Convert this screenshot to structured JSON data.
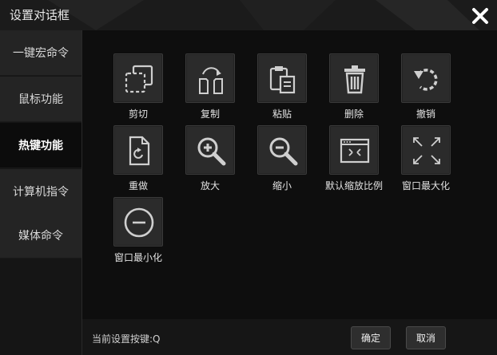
{
  "dialog": {
    "title": "设置对话框"
  },
  "sidebar": {
    "items": [
      {
        "label": "一键宏命令"
      },
      {
        "label": "鼠标功能"
      },
      {
        "label": "热键功能"
      },
      {
        "label": "计算机指令"
      },
      {
        "label": "媒体命令"
      }
    ],
    "active_index": 2
  },
  "tiles": [
    {
      "label": "剪切",
      "icon": "cut-icon"
    },
    {
      "label": "复制",
      "icon": "copy-icon"
    },
    {
      "label": "粘贴",
      "icon": "paste-icon"
    },
    {
      "label": "删除",
      "icon": "trash-icon"
    },
    {
      "label": "撤销",
      "icon": "undo-icon"
    },
    {
      "label": "重做",
      "icon": "redo-icon"
    },
    {
      "label": "放大",
      "icon": "zoom-in-icon"
    },
    {
      "label": "缩小",
      "icon": "zoom-out-icon"
    },
    {
      "label": "默认缩放比例",
      "icon": "default-zoom-icon"
    },
    {
      "label": "窗口最大化",
      "icon": "maximize-icon"
    },
    {
      "label": "窗口最小化",
      "icon": "minimize-icon"
    }
  ],
  "footer": {
    "status": "当前设置按键:Q",
    "ok_label": "确定",
    "cancel_label": "取消"
  },
  "colors": {
    "background": "#1b1b1b",
    "content": "#0e0e0e",
    "tile": "#2b2b2b",
    "icon": "#d6d6d6"
  }
}
